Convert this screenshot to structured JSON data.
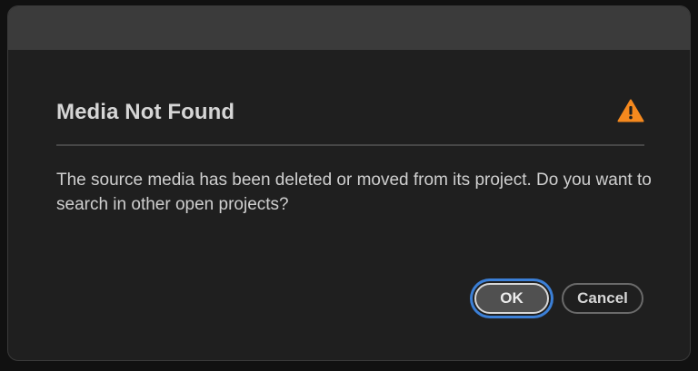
{
  "dialog": {
    "title": "Media Not Found",
    "icon": "warning-icon",
    "message": "The source media has been deleted or moved from its project. Do you want to search in other open projects?",
    "buttons": {
      "ok_label": "OK",
      "cancel_label": "Cancel"
    }
  },
  "colors": {
    "warning": "#f5891e",
    "focus_ring": "#3b7fd6",
    "dialog_bg": "#1f1f1f",
    "titlebar_bg": "#3b3b3b"
  }
}
